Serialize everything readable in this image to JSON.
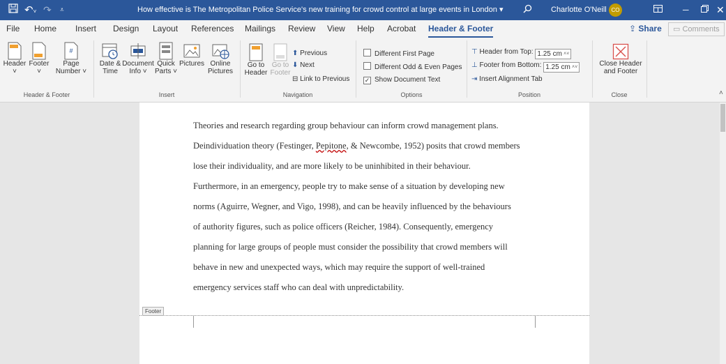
{
  "titlebar": {
    "save_icon": "save-icon",
    "undo_icon": "undo-icon",
    "redo_icon": "redo-icon",
    "qat_icon": "customize-quick-access-icon",
    "doc_title": "How effective is The Metropolitan Police Service's new training for crowd control at large events in London",
    "title_caret": "▾",
    "user_name": "Charlotte O'Neill",
    "avatar_initials": "CO",
    "avatar_color": "#c19c00"
  },
  "tabs": [
    "File",
    "Home",
    "Insert",
    "Design",
    "Layout",
    "References",
    "Mailings",
    "Review",
    "View",
    "Help",
    "Acrobat",
    "Header & Footer"
  ],
  "share_label": "Share",
  "comments_label": "Comments",
  "ribbon": {
    "header_footer_group": {
      "header": "Header",
      "footer": "Footer",
      "page_number": [
        "Page",
        "Number ˅"
      ],
      "label": "Header & Footer"
    },
    "insert_group": {
      "date_time": [
        "Date &",
        "Time"
      ],
      "doc_info": [
        "Document",
        "Info ˅"
      ],
      "quick_parts": [
        "Quick",
        "Parts ˅"
      ],
      "pictures": "Pictures",
      "online_pictures": [
        "Online",
        "Pictures"
      ],
      "label": "Insert"
    },
    "navigation_group": {
      "go_to_header": [
        "Go to",
        "Header"
      ],
      "go_to_footer": [
        "Go to",
        "Footer"
      ],
      "previous": "Previous",
      "next": "Next",
      "link_to_previous": "Link to Previous",
      "label": "Navigation"
    },
    "options_group": {
      "different_first_page": "Different First Page",
      "different_odd_even": "Different Odd & Even Pages",
      "show_document_text": "Show Document Text",
      "label": "Options"
    },
    "position_group": {
      "header_from_top_label": "Header from Top:",
      "header_from_top_value": "1.25 cm",
      "footer_from_bottom_label": "Footer from Bottom:",
      "footer_from_bottom_value": "1.25 cm",
      "insert_alignment_tab": "Insert Alignment Tab",
      "label": "Position"
    },
    "close_group": {
      "close_header_footer": [
        "Close Header",
        "and Footer"
      ],
      "label": "Close"
    }
  },
  "document": {
    "lines": [
      "Theories and research regarding group behaviour can inform crowd management plans.",
      "lose their individuality, and are more likely to be uninhibited in their behaviour.",
      "Furthermore, in an emergency, people try to make sense of a situation by developing new",
      "norms (Aguirre, Wegner, and Vigo, 1998), and can be heavily influenced by the behaviours",
      "of authority figures, such as police officers (Reicher, 1984).  Consequently, emergency",
      "planning for large groups of people must consider the possibility that crowd members will",
      "behave in new and unexpected ways, which may require the support of well-trained",
      "emergency services staff who can deal with unpredictability."
    ],
    "line2_before": "Deindividuation theory (Festinger, ",
    "line2_misspelled": "Pepitone",
    "line2_after": ", & Newcombe, 1952) posits that crowd members",
    "footer_tag": "Footer"
  }
}
